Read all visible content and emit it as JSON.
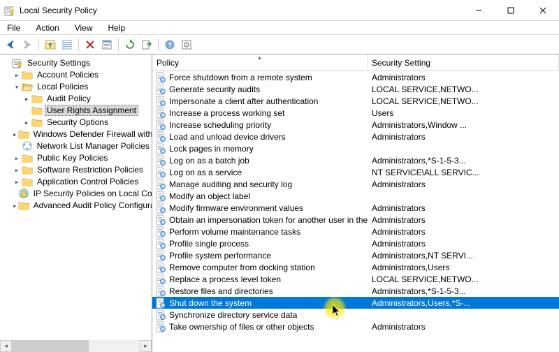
{
  "window": {
    "title": "Local Security Policy"
  },
  "menubar": {
    "file": "File",
    "action": "Action",
    "view": "View",
    "help": "Help"
  },
  "tree": {
    "root": "Security Settings",
    "account_policies": "Account Policies",
    "local_policies": "Local Policies",
    "audit_policy": "Audit Policy",
    "user_rights": "User Rights Assignment",
    "security_options": "Security Options",
    "firewall": "Windows Defender Firewall with Advanced Security",
    "netlist": "Network List Manager Policies",
    "publickey": "Public Key Policies",
    "swrestrict": "Software Restriction Policies",
    "appcontrol": "Application Control Policies",
    "ipsec": "IP Security Policies on Local Computer",
    "advaudit": "Advanced Audit Policy Configuration"
  },
  "list": {
    "header": {
      "policy": "Policy",
      "setting": "Security Setting"
    },
    "rows": [
      {
        "policy": "Force shutdown from a remote system",
        "setting": "Administrators"
      },
      {
        "policy": "Generate security audits",
        "setting": "LOCAL SERVICE,NETWO..."
      },
      {
        "policy": "Impersonate a client after authentication",
        "setting": "LOCAL SERVICE,NETWO..."
      },
      {
        "policy": "Increase a process working set",
        "setting": "Users"
      },
      {
        "policy": "Increase scheduling priority",
        "setting": "Administrators,Window ..."
      },
      {
        "policy": "Load and unload device drivers",
        "setting": "Administrators"
      },
      {
        "policy": "Lock pages in memory",
        "setting": ""
      },
      {
        "policy": "Log on as a batch job",
        "setting": "Administrators,*S-1-5-3..."
      },
      {
        "policy": "Log on as a service",
        "setting": "NT SERVICE\\ALL SERVIC..."
      },
      {
        "policy": "Manage auditing and security log",
        "setting": "Administrators"
      },
      {
        "policy": "Modify an object label",
        "setting": ""
      },
      {
        "policy": "Modify firmware environment values",
        "setting": "Administrators"
      },
      {
        "policy": "Obtain an impersonation token for another user in the same...",
        "setting": "Administrators"
      },
      {
        "policy": "Perform volume maintenance tasks",
        "setting": "Administrators"
      },
      {
        "policy": "Profile single process",
        "setting": "Administrators"
      },
      {
        "policy": "Profile system performance",
        "setting": "Administrators,NT SERVI..."
      },
      {
        "policy": "Remove computer from docking station",
        "setting": "Administrators,Users"
      },
      {
        "policy": "Replace a process level token",
        "setting": "LOCAL SERVICE,NETWO..."
      },
      {
        "policy": "Restore files and directories",
        "setting": "Administrators,*S-1-5-3..."
      },
      {
        "policy": "Shut down the system",
        "setting": "Administrators,Users,*S-...",
        "selected": true
      },
      {
        "policy": "Synchronize directory service data",
        "setting": ""
      },
      {
        "policy": "Take ownership of files or other objects",
        "setting": "Administrators"
      }
    ]
  }
}
